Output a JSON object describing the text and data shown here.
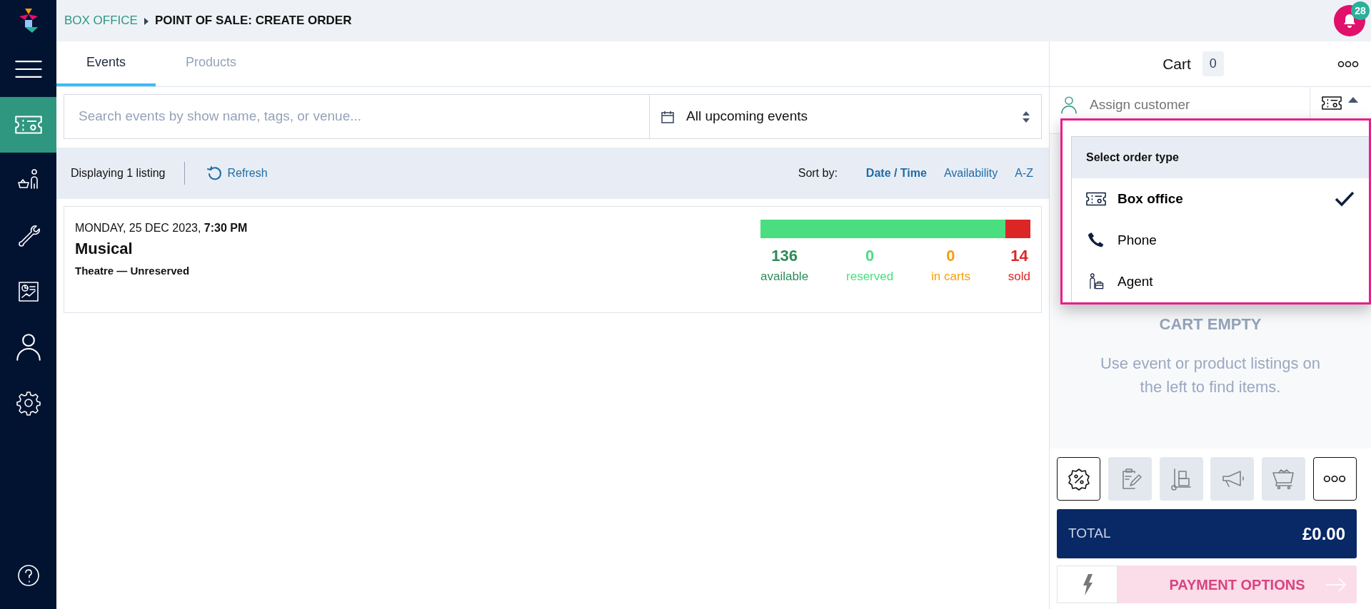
{
  "sidebar": {
    "items": [
      {
        "selected": false
      },
      {
        "selected": true
      },
      {
        "selected": false
      },
      {
        "selected": false
      },
      {
        "selected": false
      },
      {
        "selected": false
      },
      {
        "selected": false
      }
    ]
  },
  "breadcrumb": {
    "parent": "BOX OFFICE",
    "current": "POINT OF SALE: CREATE ORDER"
  },
  "notifications": {
    "count": "28"
  },
  "tabs": [
    {
      "label": "Events",
      "selected": true
    },
    {
      "label": "Products",
      "selected": false
    }
  ],
  "search": {
    "placeholder": "Search events by show name, tags, or venue..."
  },
  "date_filter": {
    "value": "All upcoming events"
  },
  "listing_bar": {
    "summary": "Displaying 1 listing",
    "refresh": "Refresh",
    "sort_label": "Sort by:",
    "sort_options": [
      {
        "label": "Date / Time",
        "selected": true
      },
      {
        "label": "Availability",
        "selected": false
      },
      {
        "label": "A-Z",
        "selected": false
      }
    ]
  },
  "events": [
    {
      "date": "MONDAY, 25 DEC 2023, **7:30 PM**",
      "title": "Musical",
      "venue": "Theatre — Unreserved",
      "bar": [
        {
          "level": 0.907,
          "color": "#4ade80"
        },
        {
          "level": 0.093,
          "color": "#dc2626"
        }
      ],
      "stats": [
        {
          "value": "136",
          "label": "available",
          "color": "#2e8b57"
        },
        {
          "value": "0",
          "label": "reserved",
          "color": "#4ade80"
        },
        {
          "value": "0",
          "label": "in carts",
          "color": "#f59e0b"
        },
        {
          "value": "14",
          "label": "sold",
          "color": "#dc2626"
        }
      ]
    }
  ],
  "cart": {
    "title": "Cart",
    "count": "0",
    "customer_placeholder": "Assign customer",
    "empty_title": "CART EMPTY",
    "empty_text": "Use event or product listings on the left to find items.",
    "tools": [
      {
        "disabled": false
      },
      {
        "disabled": true
      },
      {
        "disabled": true
      },
      {
        "disabled": true
      },
      {
        "disabled": true
      },
      {
        "disabled": false
      }
    ],
    "total_label": "TOTAL",
    "total": "£0.00",
    "payment": {
      "label": "PAYMENT OPTIONS",
      "disabled": true
    }
  },
  "order_type_menu": {
    "title": "Select order type",
    "options": [
      {
        "label": "Box office",
        "selected": true
      },
      {
        "label": "Phone",
        "selected": false
      },
      {
        "label": "Agent",
        "selected": false
      }
    ]
  }
}
